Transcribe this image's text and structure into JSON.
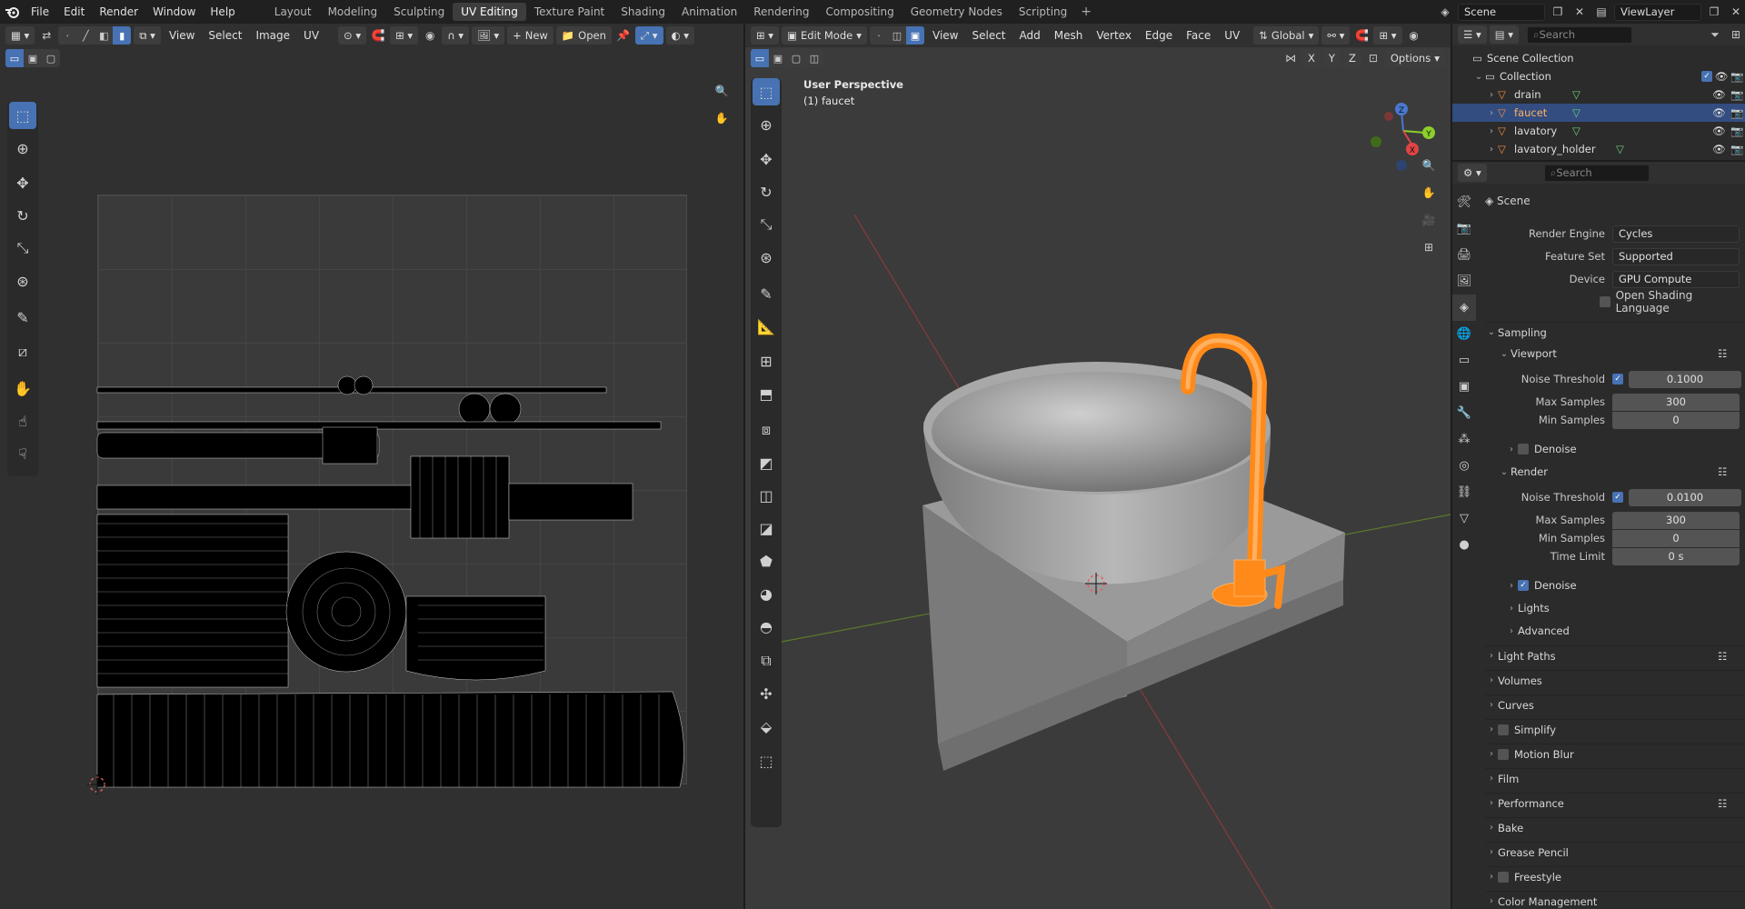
{
  "app": {
    "menu": [
      "File",
      "Edit",
      "Render",
      "Window",
      "Help"
    ],
    "workspaces": [
      "Layout",
      "Modeling",
      "Sculpting",
      "UV Editing",
      "Texture Paint",
      "Shading",
      "Animation",
      "Rendering",
      "Compositing",
      "Geometry Nodes",
      "Scripting"
    ],
    "active_workspace": "UV Editing",
    "scene": "Scene",
    "view_layer": "ViewLayer"
  },
  "uv_editor": {
    "menus": [
      "View",
      "Select",
      "Image",
      "UV"
    ],
    "new_label": "New",
    "open_label": "Open"
  },
  "viewport": {
    "mode": "Edit Mode",
    "menus": [
      "View",
      "Select",
      "Add",
      "Mesh",
      "Vertex",
      "Edge",
      "Face",
      "UV"
    ],
    "transform": "Global",
    "options": "Options",
    "overlay_title": "User Perspective",
    "overlay_object": "(1) faucet",
    "axes": [
      "X",
      "Y",
      "Z"
    ]
  },
  "outliner": {
    "search_placeholder": "Search",
    "root": "Scene Collection",
    "collection": "Collection",
    "objects": [
      {
        "name": "drain",
        "selected": false
      },
      {
        "name": "faucet",
        "selected": true
      },
      {
        "name": "lavatory",
        "selected": false
      },
      {
        "name": "lavatory_holder",
        "selected": false
      }
    ]
  },
  "properties": {
    "search_placeholder": "Search",
    "context": "Scene",
    "render_engine_label": "Render Engine",
    "render_engine": "Cycles",
    "feature_set_label": "Feature Set",
    "feature_set": "Supported",
    "device_label": "Device",
    "device": "GPU Compute",
    "osl_label": "Open Shading Language",
    "sampling": "Sampling",
    "viewport": "Viewport",
    "render": "Render",
    "noise_threshold_label": "Noise Threshold",
    "max_samples_label": "Max Samples",
    "min_samples_label": "Min Samples",
    "time_limit_label": "Time Limit",
    "vp_noise": "0.1000",
    "vp_max": "300",
    "vp_min": "0",
    "denoise": "Denoise",
    "r_noise": "0.0100",
    "r_max": "300",
    "r_min": "0",
    "r_time": "0 s",
    "lights": "Lights",
    "advanced": "Advanced",
    "sections": [
      "Light Paths",
      "Volumes",
      "Curves",
      "Simplify",
      "Motion Blur",
      "Film",
      "Performance",
      "Bake",
      "Grease Pencil",
      "Freestyle",
      "Color Management"
    ]
  },
  "colors": {
    "accent": "#4772b3",
    "selection": "#ff8a1a"
  }
}
